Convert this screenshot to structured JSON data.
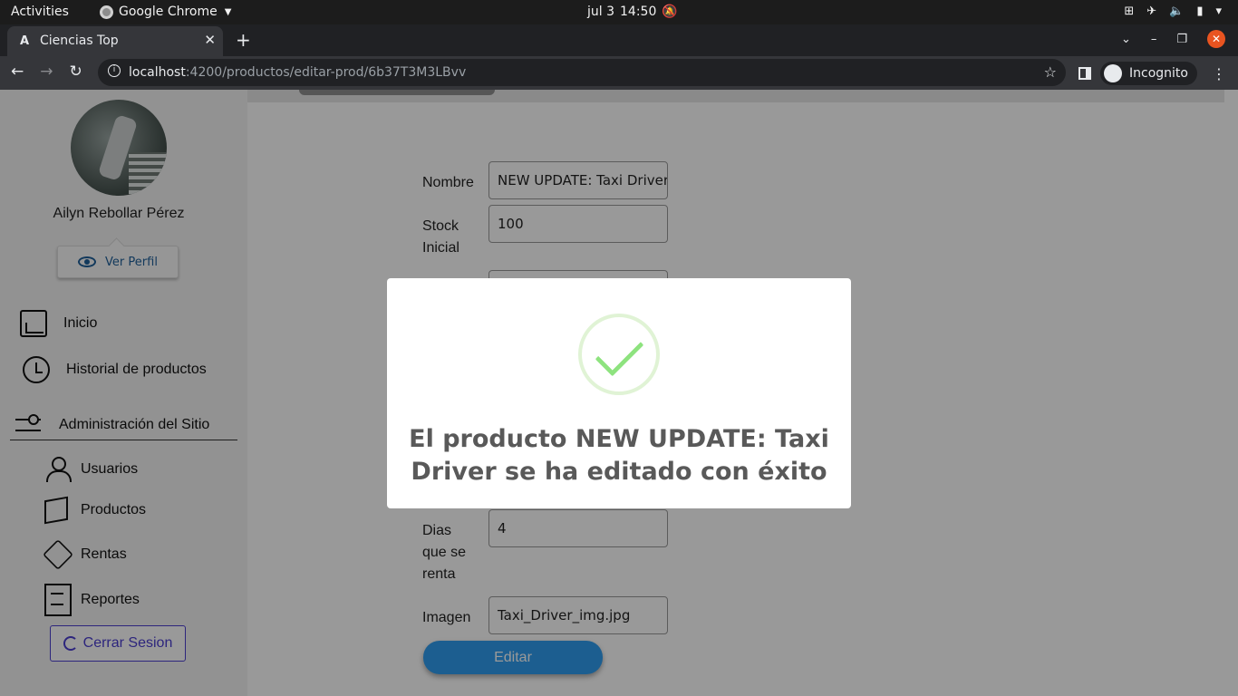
{
  "system_bar": {
    "activities": "Activities",
    "app_name": "Google Chrome",
    "date": "jul 3",
    "time": "14:50"
  },
  "browser": {
    "tab_title": "Ciencias Top",
    "url_host": "localhost",
    "url_path": ":4200/productos/editar-prod/6b37T3M3LBvv",
    "incognito_label": "Incognito"
  },
  "sidebar": {
    "user_name": "Ailyn Rebollar Pérez",
    "view_profile": "Ver Perfil",
    "items": [
      {
        "label": "Inicio"
      },
      {
        "label": "Historial de productos"
      }
    ],
    "admin_title": "Administración del Sitio",
    "admin_items": [
      {
        "label": "Usuarios"
      },
      {
        "label": "Productos"
      },
      {
        "label": "Rentas"
      },
      {
        "label": "Reportes"
      }
    ],
    "logout": "Cerrar Sesion"
  },
  "form": {
    "name_label": "Nombre",
    "name_value": "NEW UPDATE: Taxi Driver",
    "stock_label": "Stock Inicial",
    "stock_value": "100",
    "days_label": "Dias que se renta",
    "days_value": "4",
    "image_label": "Imagen",
    "image_value": "Taxi_Driver_img.jpg",
    "submit": "Editar"
  },
  "modal": {
    "message": "El producto NEW UPDATE: Taxi Driver se ha editado con éxito",
    "icon": "success-check-icon",
    "accent": "#a5dc86"
  }
}
